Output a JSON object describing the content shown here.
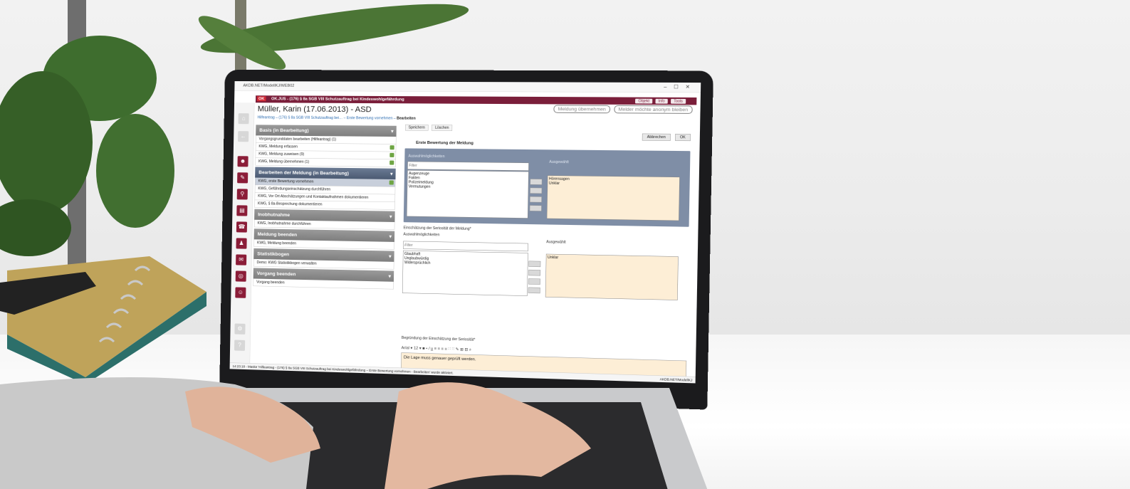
{
  "app": {
    "window_title": "AKDB.NET/ModellKJ/WEB02",
    "tab_title": "OK.JUS - (176) § 8a SGB VIII Schutzauftrag bei Kindeswohlgefährdung",
    "header_buttons": [
      "Objekt",
      "Info",
      "Tools"
    ],
    "page_title": "Müller, Karin (17.06.2013) - ASD",
    "breadcrumb_links": "Hilfeantrag – (176) § 8a SGB VIII Schutzauftrag bei… – Erste Bewertung vornehmen",
    "breadcrumb_current": "Bearbeiten",
    "top_buttons": [
      "Meldung übernehmen",
      "Melder möchte anonym bleiben"
    ],
    "toolbar": [
      "Speichern",
      "Löschen"
    ],
    "ok_buttons": [
      "Abbrechen",
      "OK"
    ],
    "form_heading": "Erste Bewertung der Meldung",
    "nav": [
      {
        "section": "Basis (in Bearbeitung)",
        "active": false,
        "items": [
          {
            "label": "Vorgangsgrunddaten bearbeiten (Hilfeantrag) (1)",
            "done": false
          },
          {
            "label": "KWG, Meldung erfassen",
            "done": true
          },
          {
            "label": "KWG, Meldung zuweisen (9)",
            "done": true
          },
          {
            "label": "KWG, Meldung übernehmen (1)",
            "done": true
          }
        ]
      },
      {
        "section": "Bearbeiten der Meldung (in Bearbeitung)",
        "active": true,
        "items": [
          {
            "label": "KWG, erste Bewertung vornehmen",
            "done": true,
            "selected": true
          },
          {
            "label": "KWG, Gefährdungseinschätzung durchführen",
            "done": false
          },
          {
            "label": "KWG, Vor Ort Abschätzungen und Kontaktaufnahmen dokumentieren",
            "done": false
          },
          {
            "label": "KWG, § 8a-Besprechung dokumentieren",
            "done": false
          }
        ]
      },
      {
        "section": "Inobhutnahme",
        "active": false,
        "items": [
          {
            "label": "KWG, Inobhutnahme durchführen",
            "done": false
          }
        ]
      },
      {
        "section": "Meldung beenden",
        "active": false,
        "items": [
          {
            "label": "KWG, Meldung beenden",
            "done": false
          }
        ]
      },
      {
        "section": "Statistikbogen",
        "active": false,
        "items": [
          {
            "label": "Demo: KWG Statistikbogen verwalten",
            "done": false
          }
        ]
      },
      {
        "section": "Vorgang beenden",
        "active": false,
        "items": [
          {
            "label": "Vorgang beenden",
            "done": false
          }
        ]
      }
    ],
    "panel1": {
      "label_available": "Auswahlmöglichkeiten",
      "label_selected": "Ausgewählt",
      "filter_placeholder": "Filter",
      "available": [
        "Augenzeuge",
        "Fakten",
        "Polizeimeldung",
        "Vermutungen"
      ],
      "selected": [
        "Hörensagen",
        "Unklar"
      ]
    },
    "panel2": {
      "title": "Einschätzung der Seriosität der Meldung*",
      "label_available": "Auswahlmöglichkeiten",
      "label_selected": "Ausgewählt",
      "filter_placeholder": "Filter",
      "available": [
        "Glaubhaft",
        "Unglaubwürdig",
        "Widersprüchlich"
      ],
      "selected": [
        "Unklar"
      ]
    },
    "editor": {
      "label": "Begründung der Einschätzung der Seriosität*",
      "font": "Arial",
      "size": "12",
      "text": "Die Lage muss genauer geprüft werden."
    },
    "status_text": "14:23:18 - Maske 'Hilfeantrag - (176) § 8a SGB VIII Schutzauftrag bei Kindeswohlgefährdung – Erste Bewertung vornehmen - Bearbeiten' wurde aktiviert.",
    "status_right": "AKDB.NET/ModellKJ"
  },
  "colors": {
    "brand": "#7a1e3a",
    "panel": "#7f8ea6",
    "selected_bg": "#fdeed6"
  }
}
